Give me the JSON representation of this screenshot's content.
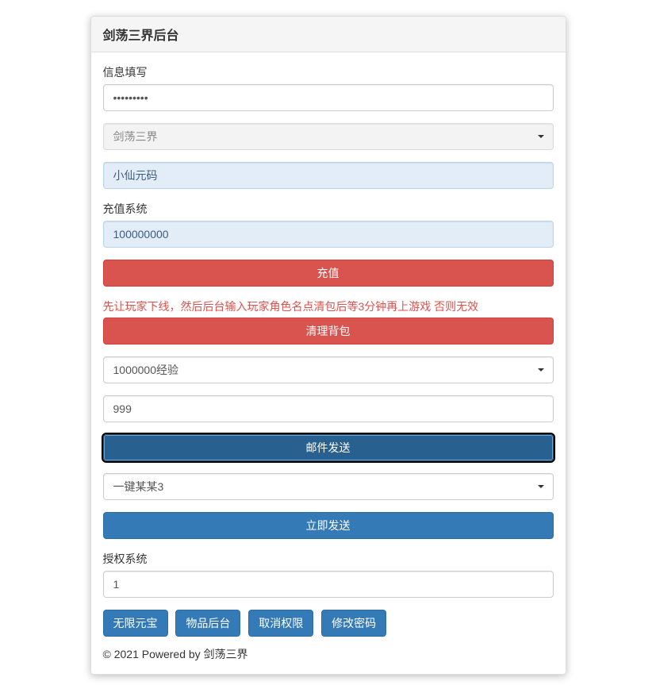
{
  "panel": {
    "title": "剑荡三界后台"
  },
  "infoSection": {
    "label": "信息填写",
    "passwordValue": "•••••••••"
  },
  "gameSelect": {
    "selected": "剑荡三界"
  },
  "characterInput": {
    "value": "小仙元码"
  },
  "rechargeSection": {
    "label": "充值系统",
    "amountValue": "100000000",
    "buttonLabel": "充值"
  },
  "clearBagSection": {
    "warning": "先让玩家下线，然后后台输入玩家角色名点清包后等3分钟再上游戏 否则无效",
    "buttonLabel": "清理背包"
  },
  "itemSelect": {
    "selected": "1000000经验"
  },
  "quantityInput": {
    "value": "999"
  },
  "mailButton": {
    "label": "邮件发送"
  },
  "presetSelect": {
    "selected": "一键某某3"
  },
  "sendNowButton": {
    "label": "立即发送"
  },
  "authSection": {
    "label": "授权系统",
    "value": "1"
  },
  "bottomButtons": {
    "btn1": "无限元宝",
    "btn2": "物品后台",
    "btn3": "取消权限",
    "btn4": "修改密码"
  },
  "footer": {
    "text": "© 2021 Powered by 剑荡三界"
  }
}
